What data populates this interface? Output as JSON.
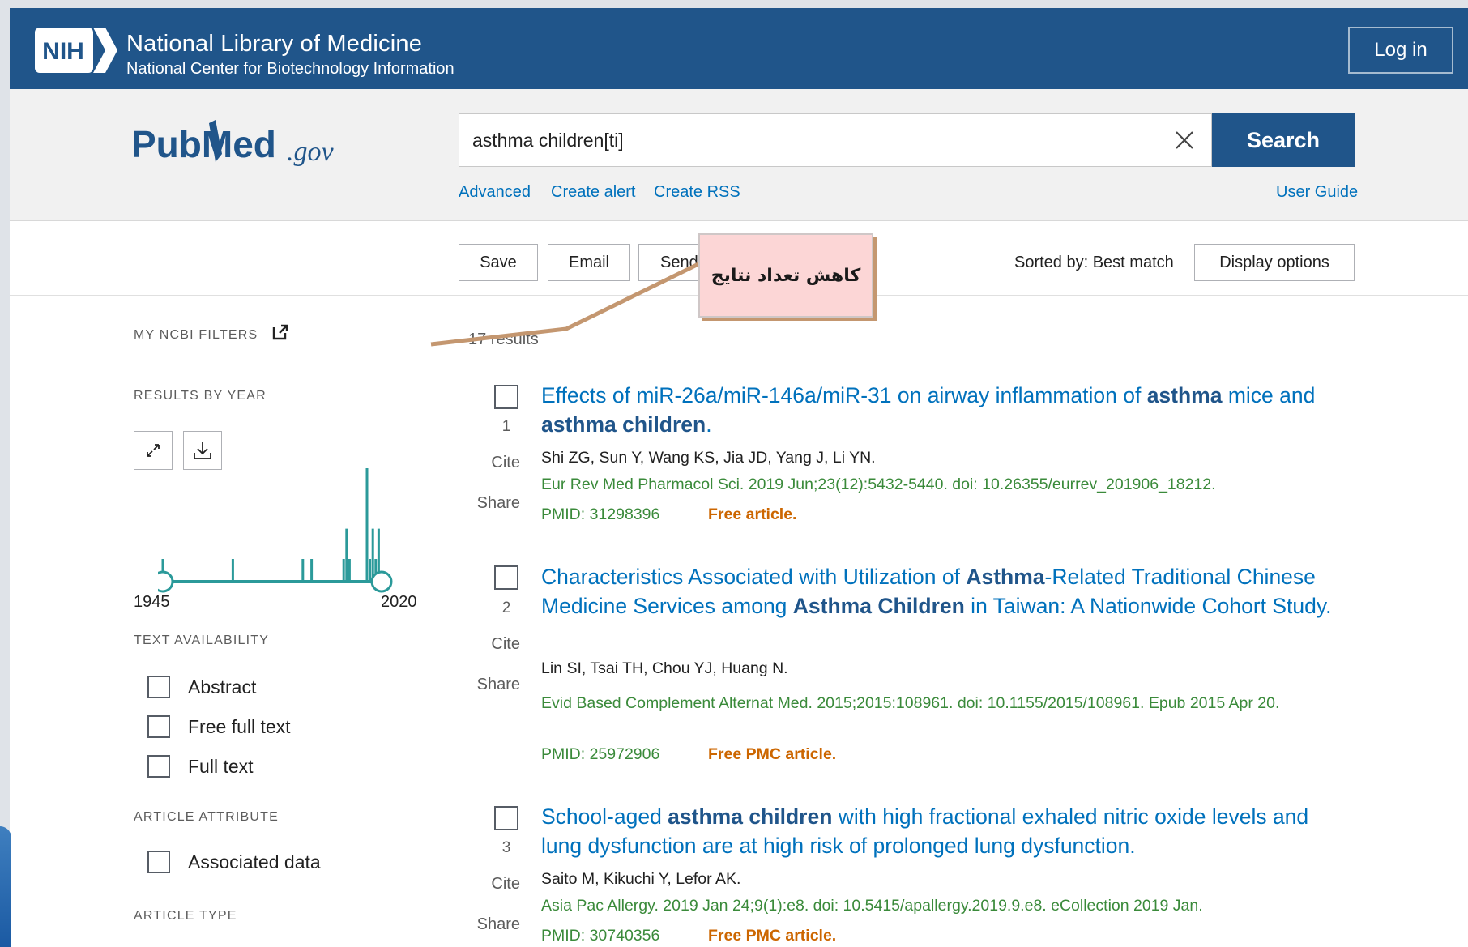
{
  "nih": {
    "logo_text": "NIH",
    "title": "National Library of Medicine",
    "subtitle": "National Center for Biotechnology Information",
    "login_label": "Log in"
  },
  "search": {
    "logo_text": "PubMed",
    "logo_suffix": ".gov",
    "query": "asthma children[ti]",
    "button_label": "Search",
    "links": [
      "Advanced",
      "Create alert",
      "Create RSS"
    ],
    "user_guide": "User Guide"
  },
  "toolbar": {
    "save": "Save",
    "email": "Email",
    "send": "Send",
    "sorted_by": "Sorted by: Best match",
    "display_options": "Display options"
  },
  "annotation": {
    "text": "کاهش تعداد نتایج",
    "fill_color": "#fcd6d6",
    "line_color": "#c49770"
  },
  "sidebar": {
    "my_filters": "MY NCBI FILTERS",
    "results_by_year": "RESULTS BY YEAR",
    "year_start": "1945",
    "year_end": "2020",
    "text_availability": "TEXT AVAILABILITY",
    "text_filters": [
      "Abstract",
      "Free full text",
      "Full text"
    ],
    "article_attribute": "ARTICLE ATTRIBUTE",
    "attribute_filters": [
      "Associated data"
    ],
    "article_type": "ARTICLE TYPE"
  },
  "results": {
    "count_text": "17 results",
    "items": [
      {
        "num": "1",
        "title_parts": [
          {
            "t": "Effects of miR-26a/miR-146a/miR-31 on airway inflammation of ",
            "b": false
          },
          {
            "t": "asthma",
            "b": true
          },
          {
            "t": " mice and ",
            "b": false
          },
          {
            "t": "asthma children",
            "b": true
          },
          {
            "t": ".",
            "b": false
          }
        ],
        "authors": "Shi ZG, Sun Y, Wang KS, Jia JD, Yang J, Li YN.",
        "journal": "Eur Rev Med Pharmacol Sci. 2019 Jun;23(12):5432-5440. doi: 10.26355/eurrev_201906_18212.",
        "pmid": "PMID: 31298396",
        "free": "Free article."
      },
      {
        "num": "2",
        "title_parts": [
          {
            "t": "Characteristics Associated with Utilization of ",
            "b": false
          },
          {
            "t": "Asthma",
            "b": true
          },
          {
            "t": "-Related Traditional Chinese Medicine Services among ",
            "b": false
          },
          {
            "t": "Asthma Children",
            "b": true
          },
          {
            "t": " in Taiwan: A Nationwide Cohort Study.",
            "b": false
          }
        ],
        "authors": "Lin SI, Tsai TH, Chou YJ, Huang N.",
        "journal": "Evid Based Complement Alternat Med. 2015;2015:108961. doi: 10.1155/2015/108961. Epub 2015 Apr 20.",
        "pmid": "PMID: 25972906",
        "free": "Free PMC article."
      },
      {
        "num": "3",
        "title_parts": [
          {
            "t": "School-aged ",
            "b": false
          },
          {
            "t": "asthma children",
            "b": true
          },
          {
            "t": " with high fractional exhaled nitric oxide levels and lung dysfunction are at high risk of prolonged lung dysfunction.",
            "b": false
          }
        ],
        "authors": "Saito M, Kikuchi Y, Lefor AK.",
        "journal": "Asia Pac Allergy. 2019 Jan 24;9(1):e8. doi: 10.5415/apallergy.2019.9.e8. eCollection 2019 Jan.",
        "pmid": "PMID: 30740356",
        "free": "Free PMC article."
      }
    ],
    "labels": {
      "cite": "Cite",
      "share": "Share"
    }
  },
  "histogram": {
    "bar_color": "#2b9a9a",
    "bars": [
      {
        "year": 1945,
        "count": 1
      },
      {
        "year": 1969,
        "count": 1
      },
      {
        "year": 1993,
        "count": 1
      },
      {
        "year": 1996,
        "count": 1
      },
      {
        "year": 2007,
        "count": 1
      },
      {
        "year": 2008,
        "count": 2
      },
      {
        "year": 2009,
        "count": 1
      },
      {
        "year": 2015,
        "count": 4
      },
      {
        "year": 2016,
        "count": 1
      },
      {
        "year": 2017,
        "count": 2
      },
      {
        "year": 2018,
        "count": 1
      },
      {
        "year": 2019,
        "count": 2
      }
    ]
  }
}
